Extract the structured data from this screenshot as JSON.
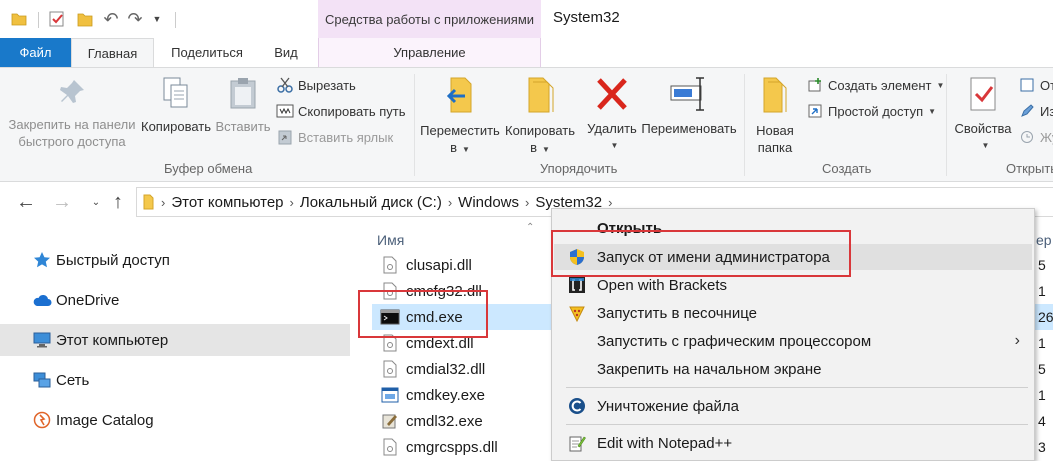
{
  "window": {
    "title": "System32",
    "contextual_group": "Средства работы с приложениями"
  },
  "tabs": {
    "file": "Файл",
    "home": "Главная",
    "share": "Поделиться",
    "view": "Вид",
    "manage": "Управление"
  },
  "ribbon": {
    "clipboard": {
      "pin_line1": "Закрепить на панели",
      "pin_line2": "быстрого доступа",
      "copy": "Копировать",
      "paste": "Вставить",
      "cut": "Вырезать",
      "copy_path": "Скопировать путь",
      "paste_shortcut": "Вставить ярлык",
      "group_label": "Буфер обмена"
    },
    "organize": {
      "move_line1": "Переместить",
      "move_line2": "в",
      "copy_line1": "Копировать",
      "copy_line2": "в",
      "delete": "Удалить",
      "rename": "Переименовать",
      "group_label": "Упорядочить"
    },
    "new": {
      "new_folder_line1": "Новая",
      "new_folder_line2": "папка",
      "new_item": "Создать элемент",
      "easy_access": "Простой доступ",
      "group_label": "Создать"
    },
    "open": {
      "properties": "Свойства",
      "partial_1": "От",
      "partial_2": "Из",
      "partial_3": "Жу",
      "group_label": "Открыть"
    }
  },
  "breadcrumb": [
    "Этот компьютер",
    "Локальный диск (C:)",
    "Windows",
    "System32"
  ],
  "nav_pane": [
    {
      "label": "Быстрый доступ",
      "icon": "star-icon"
    },
    {
      "label": "OneDrive",
      "icon": "cloud-icon"
    },
    {
      "label": "Этот компьютер",
      "icon": "computer-icon",
      "selected": true
    },
    {
      "label": "Сеть",
      "icon": "network-icon"
    },
    {
      "label": "Image Catalog",
      "icon": "image-catalog-icon"
    }
  ],
  "file_list": {
    "column_name": "Имя",
    "column_right_partial": "ер",
    "files": [
      {
        "name": "clusapi.dll",
        "icon": "dll-file-icon"
      },
      {
        "name": "cmcfg32.dll",
        "icon": "dll-file-icon"
      },
      {
        "name": "cmd.exe",
        "icon": "console-icon",
        "selected": true
      },
      {
        "name": "cmdext.dll",
        "icon": "dll-file-icon"
      },
      {
        "name": "cmdial32.dll",
        "icon": "dll-file-icon"
      },
      {
        "name": "cmdkey.exe",
        "icon": "exe-window-icon"
      },
      {
        "name": "cmdl32.exe",
        "icon": "exe-tool-icon"
      },
      {
        "name": "cmgrcspps.dll",
        "icon": "dll-file-icon"
      }
    ],
    "right_partial_values": [
      "5",
      "1",
      "26",
      "1",
      "5",
      "1",
      "4",
      "3"
    ]
  },
  "context_menu": {
    "items": [
      {
        "label": "Открыть",
        "bold": true
      },
      {
        "label": "Запуск от имени администратора",
        "icon": "uac-shield-icon",
        "highlighted": true
      },
      {
        "label": "Open with Brackets",
        "icon": "brackets-icon"
      },
      {
        "label": "Запустить в песочнице",
        "icon": "sandbox-icon"
      },
      {
        "label": "Запустить с графическим процессором",
        "submenu": true
      },
      {
        "label": "Закрепить на начальном экране"
      },
      {
        "label": "Уничтожение файла",
        "icon": "ccleaner-icon"
      },
      {
        "label": "Edit with Notepad++",
        "icon": "notepadpp-icon"
      }
    ]
  },
  "colors": {
    "accent": "#1979ca",
    "highlight_box": "#d9373a",
    "selected_row": "#cce8ff",
    "contextual_tab": "#f3e2f6"
  }
}
